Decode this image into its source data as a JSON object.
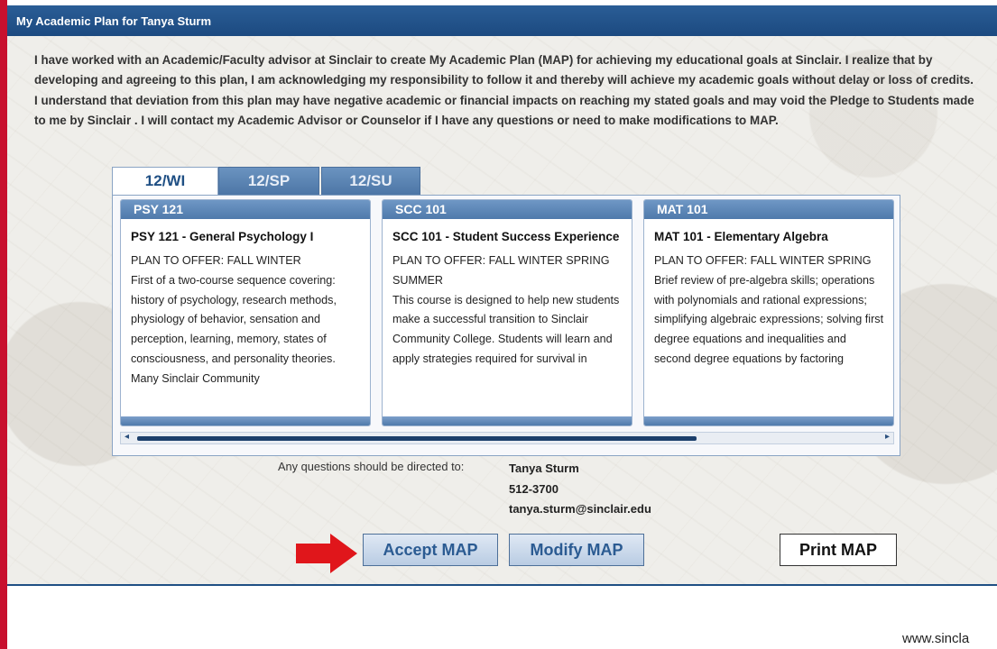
{
  "panel": {
    "title": "My Academic Plan for Tanya Sturm",
    "acknowledgement": "I have worked with an Academic/Faculty advisor at Sinclair to create My Academic Plan (MAP) for achieving my educational goals at Sinclair. I realize that by developing and agreeing to this plan, I am acknowledging my responsibility to follow it and thereby will achieve my academic goals without delay or loss of credits. I understand that deviation from this plan may have negative academic or financial impacts on reaching my stated goals and may void the Pledge to Students made to me by Sinclair . I will contact my Academic Advisor or Counselor if I have any questions or need to make modifications to MAP."
  },
  "tabs": [
    {
      "label": "12/WI",
      "active": true
    },
    {
      "label": "12/SP",
      "active": false
    },
    {
      "label": "12/SU",
      "active": false
    }
  ],
  "courses": [
    {
      "code": "PSY 121",
      "title": "PSY 121 - General Psychology I",
      "plan": "PLAN TO OFFER: FALL WINTER",
      "description": "First of a two-course sequence covering: history of psychology, research methods, physiology of behavior, sensation and perception, learning, memory, states of consciousness, and personality theories. Many Sinclair Community"
    },
    {
      "code": "SCC 101",
      "title": "SCC 101 - Student Success Experience",
      "plan": "PLAN TO OFFER: FALL WINTER SPRING SUMMER",
      "description": "This course is designed to help new students make a successful transition to Sinclair Community College. Students will learn and apply strategies required for survival in"
    },
    {
      "code": "MAT 101",
      "title": "MAT 101 - Elementary Algebra",
      "plan": "PLAN TO OFFER: FALL WINTER SPRING",
      "description": "Brief review of pre-algebra skills; operations with polynomials and rational expressions; simplifying algebraic expressions; solving first degree equations and inequalities and second degree equations by factoring"
    }
  ],
  "scrollbar": {
    "left_arrow": "◂",
    "right_arrow": "▸"
  },
  "contact": {
    "label": "Any questions should be directed to:",
    "name": "Tanya Sturm",
    "phone": "512-3700",
    "email": "tanya.sturm@sinclair.edu"
  },
  "buttons": {
    "accept": "Accept MAP",
    "modify": "Modify MAP",
    "print": "Print MAP"
  },
  "colors": {
    "accent_red": "#c8102e",
    "header_blue": "#1f4f84",
    "tab_blue": "#5a84b4"
  },
  "icons": {
    "pointer": "red-arrow-icon"
  },
  "footer": {
    "url": "www.sincla"
  }
}
